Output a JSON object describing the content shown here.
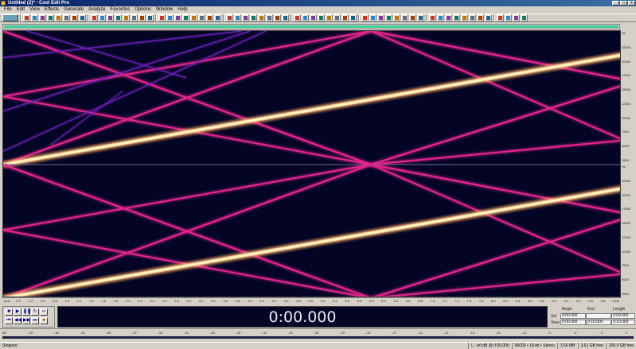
{
  "window": {
    "title": "Untitled (2)* - Cool Edit Pro"
  },
  "menu": [
    "File",
    "Edit",
    "View",
    "Effects",
    "Generate",
    "Analyze",
    "Favorites",
    "Options",
    "Window",
    "Help"
  ],
  "toolbar": {
    "button_count": 60
  },
  "spectral_view": {
    "background_color": "#040525",
    "line_colors": {
      "hot": "#fff1c8",
      "magenta": "#e0258c",
      "violet": "#6e22b8"
    }
  },
  "freq_ruler": {
    "top": [
      "Hz",
      "22000",
      "20000",
      "17500",
      "15000",
      "12500",
      "10000",
      "7500",
      "5000",
      "2500"
    ],
    "bottom": [
      "Hz",
      "22000",
      "20000",
      "17500",
      "15000",
      "12500",
      "10000",
      "7500",
      "5000",
      "2500"
    ]
  },
  "time_ruler": {
    "labels": [
      "hms",
      "0.2",
      "0.4",
      "0.6",
      "0.8",
      "1.0",
      "1.2",
      "1.4",
      "1.6",
      "1.8",
      "2.0",
      "2.2",
      "2.4",
      "2.6",
      "2.8",
      "3.0",
      "3.2",
      "3.4",
      "3.6",
      "3.8",
      "4.0",
      "4.2",
      "4.4",
      "4.6",
      "4.8",
      "5.0",
      "5.2",
      "5.4",
      "5.6",
      "5.8",
      "6.0",
      "6.2",
      "6.4",
      "6.6",
      "6.8",
      "7.0",
      "7.2",
      "7.4",
      "7.6",
      "7.8",
      "8.0",
      "8.2",
      "8.4",
      "8.6",
      "8.8",
      "9.0",
      "9.2",
      "9.4",
      "9.6",
      "9.8",
      "hms"
    ]
  },
  "transport": {
    "row1": [
      "stop-button",
      "play-button",
      "pause-button",
      "play-looped-button",
      "loop-button"
    ],
    "row2": [
      "go-to-start-button",
      "rewind-button",
      "fast-forward-button",
      "go-to-end-button",
      "record-button"
    ],
    "glyphs": {
      "stop-button": "■",
      "play-button": "▶",
      "pause-button": "❚❚",
      "play-looped-button": "↻",
      "loop-button": "∞",
      "go-to-start-button": "⏮",
      "rewind-button": "◀◀",
      "fast-forward-button": "▶▶",
      "go-to-end-button": "⏭",
      "record-button": "●"
    }
  },
  "time_display": {
    "value": "0:00.000"
  },
  "selection": {
    "headers": {
      "begin": "Begin",
      "end": "End",
      "length": "Length"
    },
    "sel": {
      "label": "Sel",
      "begin": "0:00.000",
      "end": "",
      "length": "0:00.000"
    },
    "view": {
      "label": "View",
      "begin": "0:00.000",
      "end": "0:10.000",
      "length": "0:10.000"
    }
  },
  "level_meter": {
    "labels": [
      "dB",
      "-69",
      "-66",
      "-63",
      "-60",
      "-57",
      "-54",
      "-51",
      "-48",
      "-45",
      "-42",
      "-39",
      "-36",
      "-33",
      "-30",
      "-27",
      "-24",
      "-21",
      "-18",
      "-15",
      "-12",
      "-9",
      "-6",
      "-3",
      "0"
    ]
  },
  "status": {
    "state": "Stopped",
    "cpu": "L: -Inf dB @ 0:00.000",
    "format": "96000 • 16-bit • Stereo",
    "size": "3.66 MB",
    "duration": "3.61 GB free",
    "free": "100.0 GB free"
  }
}
